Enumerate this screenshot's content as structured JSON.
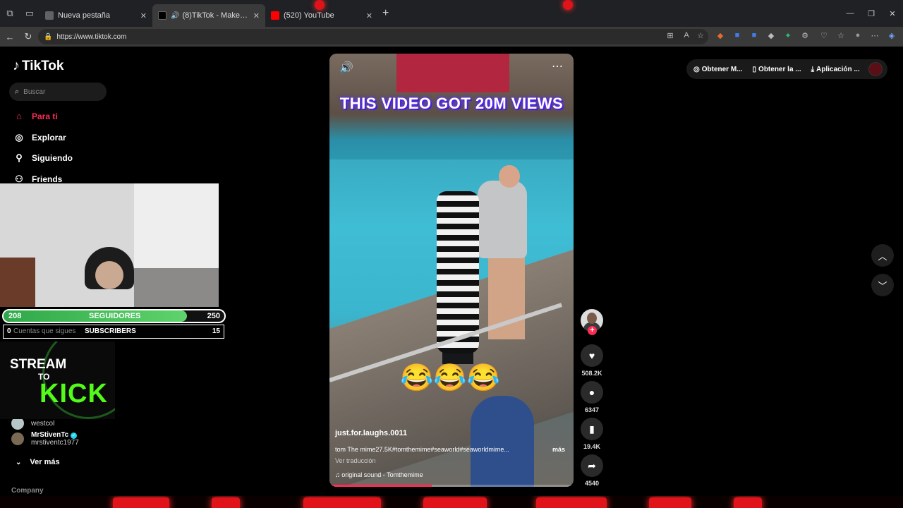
{
  "browser": {
    "tabs": [
      {
        "title": "Nueva pestaña",
        "favicon_color": "#5f6368"
      },
      {
        "title": "(8)TikTok - Make Your Day",
        "favicon_color": "#000000"
      },
      {
        "title": "(520) YouTube",
        "favicon_color": "#ff0000"
      }
    ],
    "url": "https://www.tiktok.com"
  },
  "tiktok": {
    "logo": "TikTok",
    "search_placeholder": "Buscar",
    "nav": [
      {
        "label": "Para ti",
        "icon": "home-icon",
        "active": true
      },
      {
        "label": "Explorar",
        "icon": "compass-icon",
        "active": false
      },
      {
        "label": "Siguiendo",
        "icon": "user-follow-icon",
        "active": false
      },
      {
        "label": "Friends",
        "icon": "friends-icon",
        "active": false
      }
    ],
    "following": [
      {
        "name": "",
        "handle": "westcol"
      },
      {
        "name": "MrStivenTc",
        "handle": "mrstiventc1977",
        "verified": true
      }
    ],
    "ver_mas": "Ver más",
    "company": "Company",
    "header_pills": [
      {
        "label": "Obtener M...",
        "icon": "coin-icon"
      },
      {
        "label": "Obtener la ...",
        "icon": "phone-icon"
      },
      {
        "label": "Aplicación ...",
        "icon": "download-icon"
      }
    ]
  },
  "overlay": {
    "followers_bar": {
      "current": "208",
      "label": "SEGUIDORES",
      "goal": "250",
      "progress": 0.83
    },
    "subs_bar": {
      "current": "0",
      "sub_label": "Cuentas que sigues",
      "label": "SUBSCRIBERS",
      "goal": "15"
    },
    "kick": {
      "line1": "STREAM",
      "line2": "TO",
      "line3": "KICK"
    }
  },
  "video": {
    "caption_overlay": "THIS VIDEO GOT 20M VIEWS",
    "emoji": "😂😂😂",
    "author": "just.for.laughs.0011",
    "description": "tom The mime27.5K#tomthemime#seaworld#seaworldmime...",
    "more": "más",
    "translate": "Ver traducción",
    "music": "original sound - Tomthemime",
    "progress": 0.42
  },
  "actions": {
    "likes": "508.2K",
    "comments": "6347",
    "saves": "19.4K",
    "shares": "4540"
  },
  "colors": {
    "accent": "#fe2c55",
    "kick_green": "#53fc18",
    "bar_green": "#2fa84a"
  }
}
